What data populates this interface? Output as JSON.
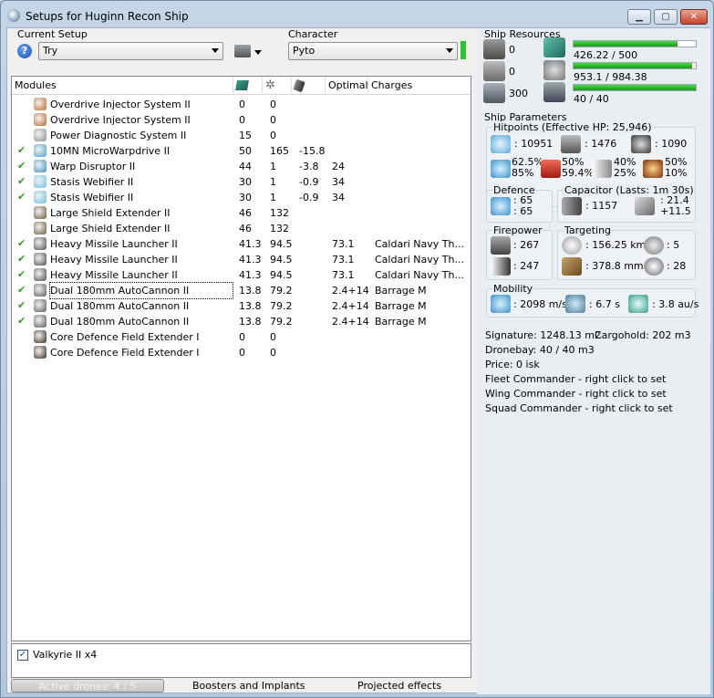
{
  "window": {
    "title": "Setups for Huginn Recon Ship"
  },
  "setup": {
    "label": "Current Setup",
    "value": "Try"
  },
  "character": {
    "label": "Character",
    "value": "Pyto"
  },
  "modules": {
    "headers": [
      "Modules",
      "",
      "",
      "",
      "Optimal",
      "Charges"
    ],
    "rows": [
      {
        "checked": false,
        "name": "Overdrive Injector System II",
        "cpu": "0",
        "pg": "0",
        "cap": "",
        "optimal": "",
        "charge": "",
        "color": "#b86a2e"
      },
      {
        "checked": false,
        "name": "Overdrive Injector System II",
        "cpu": "0",
        "pg": "0",
        "cap": "",
        "optimal": "",
        "charge": "",
        "color": "#b86a2e"
      },
      {
        "checked": false,
        "name": "Power Diagnostic System II",
        "cpu": "15",
        "pg": "0",
        "cap": "",
        "optimal": "",
        "charge": "",
        "color": "#8a8f95"
      },
      {
        "checked": true,
        "name": "10MN MicroWarpdrive II",
        "cpu": "50",
        "pg": "165",
        "cap": "-15.8",
        "optimal": "",
        "charge": "",
        "color": "#4aa3c9"
      },
      {
        "checked": true,
        "name": "Warp Disruptor II",
        "cpu": "44",
        "pg": "1",
        "cap": "-3.8",
        "optimal": "24",
        "charge": "",
        "color": "#3f8fc2"
      },
      {
        "checked": true,
        "name": "Stasis Webifier II",
        "cpu": "30",
        "pg": "1",
        "cap": "-0.9",
        "optimal": "34",
        "charge": "",
        "color": "#6cc2e0"
      },
      {
        "checked": true,
        "name": "Stasis Webifier II",
        "cpu": "30",
        "pg": "1",
        "cap": "-0.9",
        "optimal": "34",
        "charge": "",
        "color": "#6cc2e0"
      },
      {
        "checked": false,
        "name": "Large Shield Extender II",
        "cpu": "46",
        "pg": "132",
        "cap": "",
        "optimal": "",
        "charge": "",
        "color": "#6b5a3a"
      },
      {
        "checked": false,
        "name": "Large Shield Extender II",
        "cpu": "46",
        "pg": "132",
        "cap": "",
        "optimal": "",
        "charge": "",
        "color": "#6b5a3a"
      },
      {
        "checked": true,
        "name": "Heavy Missile Launcher II",
        "cpu": "41.3",
        "pg": "94.5",
        "cap": "",
        "optimal": "73.1",
        "charge": "Caldari Navy Th...",
        "color": "#4d4d4d"
      },
      {
        "checked": true,
        "name": "Heavy Missile Launcher II",
        "cpu": "41.3",
        "pg": "94.5",
        "cap": "",
        "optimal": "73.1",
        "charge": "Caldari Navy Th...",
        "color": "#4d4d4d"
      },
      {
        "checked": true,
        "name": "Heavy Missile Launcher II",
        "cpu": "41.3",
        "pg": "94.5",
        "cap": "",
        "optimal": "73.1",
        "charge": "Caldari Navy Th...",
        "color": "#4d4d4d"
      },
      {
        "checked": true,
        "name": "Dual 180mm AutoCannon II",
        "cpu": "13.8",
        "pg": "79.2",
        "cap": "",
        "optimal": "2.4+14",
        "charge": "Barrage M",
        "color": "#5a5a5a",
        "focused": true
      },
      {
        "checked": true,
        "name": "Dual 180mm AutoCannon II",
        "cpu": "13.8",
        "pg": "79.2",
        "cap": "",
        "optimal": "2.4+14",
        "charge": "Barrage M",
        "color": "#5a5a5a"
      },
      {
        "checked": true,
        "name": "Dual 180mm AutoCannon II",
        "cpu": "13.8",
        "pg": "79.2",
        "cap": "",
        "optimal": "2.4+14",
        "charge": "Barrage M",
        "color": "#5a5a5a"
      },
      {
        "checked": false,
        "name": "Core Defence Field Extender I",
        "cpu": "0",
        "pg": "0",
        "cap": "",
        "optimal": "",
        "charge": "",
        "color": "#3a2a1a"
      },
      {
        "checked": false,
        "name": "Core Defence Field Extender I",
        "cpu": "0",
        "pg": "0",
        "cap": "",
        "optimal": "",
        "charge": "",
        "color": "#3a2a1a"
      }
    ]
  },
  "drones": {
    "item": "Valkyrie II x4"
  },
  "tabs": {
    "active_drones": "Active drones: 4 / 5",
    "boosters": "Boosters and Implants",
    "projected": "Projected effects"
  },
  "resources": {
    "title": "Ship Resources",
    "turret": "0",
    "launcher": "0",
    "calibration": "300",
    "cpu": "426.22 / 500",
    "cpu_fraction": 0.852,
    "power": "953.1 / 984.38",
    "power_fraction": 0.968,
    "drone_bw": "40 / 40",
    "drone_fraction": 1.0
  },
  "params": {
    "title": "Ship Parameters",
    "hitpoints_title": "Hitpoints (Effective HP: 25,946)",
    "hp_shield": ": 10951",
    "hp_armor": ": 1476",
    "hp_hull": ": 1090",
    "res_shield_em": "62.5%",
    "res_shield_therm": "85%",
    "res_armor_em": "50%",
    "res_armor_therm": "59.4%",
    "res_kin_1": "40%",
    "res_kin_2": "25%",
    "res_exp_1": "50%",
    "res_exp_2": "10%",
    "defence_title": "Defence",
    "def_1": ": 65",
    "def_2": ": 65",
    "capacitor_title": "Capacitor (Lasts: 1m 30s)",
    "cap_amount": ": 1157",
    "cap_rate_1": ": 21.4",
    "cap_rate_2": "+11.5",
    "firepower_title": "Firepower",
    "fire_1": ": 267",
    "fire_2": ": 247",
    "targeting_title": "Targeting",
    "target_range": ": 156.25 km",
    "max_targets": ": 5",
    "sensor_strength": ": 378.8 mm",
    "scan_res": ": 28",
    "mobility_title": "Mobility",
    "speed": ": 2098 m/s",
    "align": ": 6.7 s",
    "warp": ": 3.8 au/s"
  },
  "info": {
    "signature": "Signature: 1248.13 m2",
    "cargohold": "Cargohold: 202 m3",
    "dronebay": "Dronebay: 40 / 40 m3",
    "price": "Price: 0 isk",
    "fleet": "Fleet Commander - right click to set",
    "wing": "Wing Commander - right click to set",
    "squad": "Squad Commander - right click to set"
  }
}
